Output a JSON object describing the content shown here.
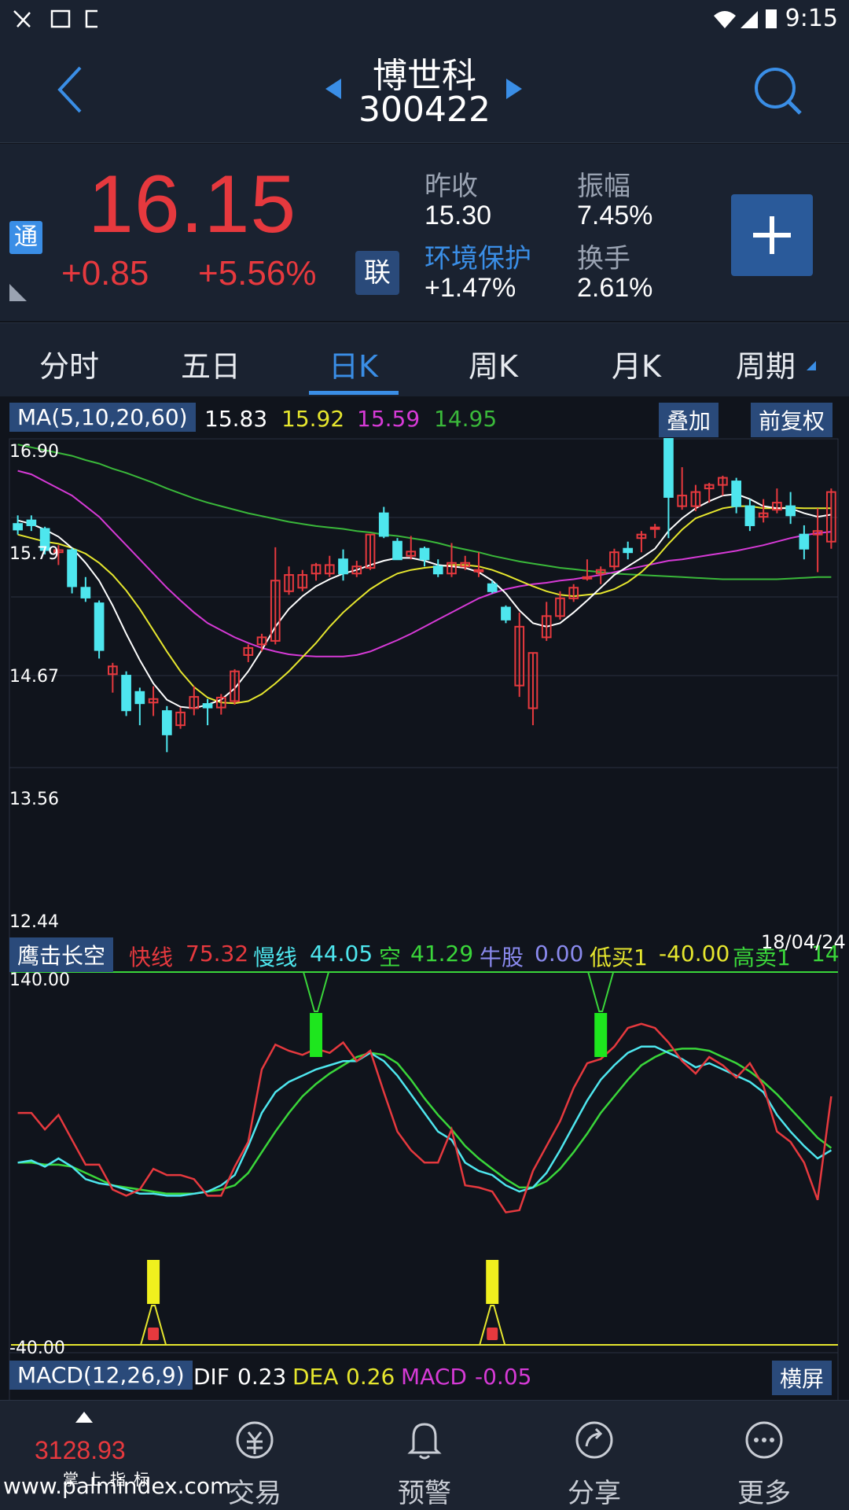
{
  "status_bar": {
    "time": "9:15"
  },
  "header": {
    "stock_name": "博世科",
    "stock_code": "300422"
  },
  "quote": {
    "price": "16.15",
    "change": "+0.85",
    "change_pct": "+5.56%",
    "badge_tong": "通",
    "badge_lian": "联",
    "prev_close_label": "昨收",
    "prev_close": "15.30",
    "amplitude_label": "振幅",
    "amplitude": "7.45%",
    "sector_label": "环境保护",
    "sector_change": "+1.47%",
    "turnover_label": "换手",
    "turnover": "2.61%"
  },
  "tabs": [
    "分时",
    "五日",
    "日K",
    "周K",
    "月K",
    "周期"
  ],
  "active_tab": "日K",
  "ma_legend": {
    "label": "MA(5,10,20,60)",
    "ma5": "15.83",
    "ma10": "15.92",
    "ma20": "15.59",
    "ma60": "14.95",
    "overlay_button": "叠加",
    "adjust_button": "前复权"
  },
  "price_axis": [
    "16.90",
    "15.79",
    "14.67",
    "13.56",
    "12.44"
  ],
  "date_label": "18/04/24",
  "indicator_legend": {
    "name": "鹰击长空",
    "fast_label": "快线",
    "fast": "75.32",
    "slow_label": "慢线",
    "slow": "44.05",
    "empty_label": "空",
    "empty": "41.29",
    "bull_label": "牛股",
    "bull": "0.00",
    "lowbuy_label": "低买1",
    "lowbuy": "-40.00",
    "highsell_label": "高卖1",
    "highsell": "14"
  },
  "indicator_axis": [
    "140.00",
    "-40.00"
  ],
  "macd_legend": {
    "label": "MACD(12,26,9)",
    "dif_label": "DIF",
    "dif": "0.23",
    "dea_label": "DEA",
    "dea": "0.26",
    "macd_label": "MACD",
    "macd": "-0.05",
    "landscape_button": "横屏"
  },
  "bottom_nav": {
    "index_value": "3128.93",
    "index_caption": "掌上指标",
    "watermark": "www.palmindex.com",
    "items": [
      "交易",
      "预警",
      "分享",
      "更多"
    ]
  },
  "colors": {
    "up": "#e6393e",
    "down": "#4ee6ee",
    "ma5": "#ffffff",
    "ma10": "#e6e62e",
    "ma20": "#d63ad6",
    "ma60": "#3ab83a",
    "accent": "#3a8ee6"
  },
  "chart_data": {
    "type": "candlestick",
    "ylim": [
      12.44,
      16.9
    ],
    "candles": [
      {
        "o": 15.7,
        "h": 15.82,
        "l": 15.55,
        "c": 15.62
      },
      {
        "o": 15.75,
        "h": 15.82,
        "l": 15.6,
        "c": 15.68
      },
      {
        "o": 15.63,
        "h": 15.66,
        "l": 15.27,
        "c": 15.33
      },
      {
        "o": 15.3,
        "h": 15.4,
        "l": 15.12,
        "c": 15.33
      },
      {
        "o": 15.33,
        "h": 15.36,
        "l": 14.72,
        "c": 14.82
      },
      {
        "o": 14.8,
        "h": 14.95,
        "l": 14.6,
        "c": 14.66
      },
      {
        "o": 14.58,
        "h": 14.62,
        "l": 13.8,
        "c": 13.92
      },
      {
        "o": 13.58,
        "h": 13.74,
        "l": 13.32,
        "c": 13.69
      },
      {
        "o": 13.56,
        "h": 13.62,
        "l": 12.99,
        "c": 13.07
      },
      {
        "o": 13.33,
        "h": 13.39,
        "l": 12.86,
        "c": 13.17
      },
      {
        "o": 13.18,
        "h": 13.41,
        "l": 12.99,
        "c": 13.23
      },
      {
        "o": 13.06,
        "h": 13.13,
        "l": 12.48,
        "c": 12.73
      },
      {
        "o": 12.86,
        "h": 13.11,
        "l": 12.81,
        "c": 13.04
      },
      {
        "o": 13.1,
        "h": 13.41,
        "l": 13.0,
        "c": 13.26
      },
      {
        "o": 13.16,
        "h": 13.23,
        "l": 12.86,
        "c": 13.11
      },
      {
        "o": 13.11,
        "h": 13.3,
        "l": 13.01,
        "c": 13.25
      },
      {
        "o": 13.2,
        "h": 13.65,
        "l": 13.15,
        "c": 13.62
      },
      {
        "o": 13.85,
        "h": 14.0,
        "l": 13.75,
        "c": 13.95
      },
      {
        "o": 14.0,
        "h": 14.15,
        "l": 13.9,
        "c": 14.1
      },
      {
        "o": 14.05,
        "h": 15.37,
        "l": 14.0,
        "c": 14.9
      },
      {
        "o": 14.75,
        "h": 15.1,
        "l": 14.7,
        "c": 14.98
      },
      {
        "o": 14.8,
        "h": 15.05,
        "l": 14.75,
        "c": 14.98
      },
      {
        "o": 15.0,
        "h": 15.15,
        "l": 14.9,
        "c": 15.12
      },
      {
        "o": 15.0,
        "h": 15.25,
        "l": 14.95,
        "c": 15.12
      },
      {
        "o": 15.2,
        "h": 15.34,
        "l": 14.9,
        "c": 15.0
      },
      {
        "o": 15.0,
        "h": 15.18,
        "l": 14.95,
        "c": 15.1
      },
      {
        "o": 15.08,
        "h": 15.55,
        "l": 15.05,
        "c": 15.55
      },
      {
        "o": 15.85,
        "h": 15.94,
        "l": 15.5,
        "c": 15.53
      },
      {
        "o": 15.45,
        "h": 15.5,
        "l": 15.2,
        "c": 15.2
      },
      {
        "o": 15.25,
        "h": 15.53,
        "l": 15.2,
        "c": 15.31
      },
      {
        "o": 15.35,
        "h": 15.38,
        "l": 15.1,
        "c": 15.2
      },
      {
        "o": 15.1,
        "h": 15.2,
        "l": 14.95,
        "c": 15.0
      },
      {
        "o": 15.0,
        "h": 15.43,
        "l": 14.95,
        "c": 15.15
      },
      {
        "o": 15.1,
        "h": 15.25,
        "l": 15.05,
        "c": 15.15
      },
      {
        "o": 15.05,
        "h": 15.3,
        "l": 14.95,
        "c": 15.05
      },
      {
        "o": 14.85,
        "h": 14.9,
        "l": 14.72,
        "c": 14.75
      },
      {
        "o": 14.52,
        "h": 14.55,
        "l": 14.3,
        "c": 14.35
      },
      {
        "o": 13.42,
        "h": 14.45,
        "l": 13.26,
        "c": 14.25
      },
      {
        "o": 13.1,
        "h": 13.88,
        "l": 12.86,
        "c": 13.88
      },
      {
        "o": 14.1,
        "h": 14.6,
        "l": 14.05,
        "c": 14.4
      },
      {
        "o": 14.4,
        "h": 14.75,
        "l": 14.35,
        "c": 14.65
      },
      {
        "o": 14.65,
        "h": 14.85,
        "l": 14.6,
        "c": 14.8
      },
      {
        "o": 14.95,
        "h": 15.2,
        "l": 14.9,
        "c": 14.95
      },
      {
        "o": 15.0,
        "h": 15.1,
        "l": 14.85,
        "c": 15.05
      },
      {
        "o": 15.1,
        "h": 15.35,
        "l": 15.05,
        "c": 15.3
      },
      {
        "o": 15.35,
        "h": 15.45,
        "l": 15.2,
        "c": 15.3
      },
      {
        "o": 15.5,
        "h": 15.6,
        "l": 15.3,
        "c": 15.55
      },
      {
        "o": 15.65,
        "h": 15.7,
        "l": 15.5,
        "c": 15.65
      },
      {
        "o": 16.9,
        "h": 16.9,
        "l": 15.5,
        "c": 16.08
      },
      {
        "o": 15.95,
        "h": 16.5,
        "l": 15.9,
        "c": 16.1
      },
      {
        "o": 15.95,
        "h": 16.25,
        "l": 15.88,
        "c": 16.15
      },
      {
        "o": 16.2,
        "h": 16.28,
        "l": 16.0,
        "c": 16.25
      },
      {
        "o": 16.25,
        "h": 16.38,
        "l": 16.1,
        "c": 16.35
      },
      {
        "o": 16.3,
        "h": 16.35,
        "l": 15.85,
        "c": 15.95
      },
      {
        "o": 15.95,
        "h": 16.05,
        "l": 15.6,
        "c": 15.68
      },
      {
        "o": 15.8,
        "h": 16.05,
        "l": 15.72,
        "c": 15.85
      },
      {
        "o": 15.9,
        "h": 16.2,
        "l": 15.85,
        "c": 16.0
      },
      {
        "o": 15.95,
        "h": 16.15,
        "l": 15.7,
        "c": 15.82
      },
      {
        "o": 15.55,
        "h": 15.68,
        "l": 15.2,
        "c": 15.35
      },
      {
        "o": 15.55,
        "h": 15.92,
        "l": 15.02,
        "c": 15.6
      },
      {
        "o": 15.45,
        "h": 16.2,
        "l": 15.35,
        "c": 16.15
      }
    ],
    "ma": {
      "ma5": [
        15.75,
        15.7,
        15.62,
        15.52,
        15.36,
        15.15,
        14.9,
        14.55,
        14.15,
        13.78,
        13.45,
        13.22,
        13.12,
        13.1,
        13.15,
        13.22,
        13.38,
        13.62,
        13.92,
        14.25,
        14.5,
        14.68,
        14.82,
        14.92,
        15.0,
        15.05,
        15.12,
        15.18,
        15.22,
        15.22,
        15.18,
        15.12,
        15.1,
        15.08,
        15.02,
        14.9,
        14.72,
        14.48,
        14.3,
        14.25,
        14.3,
        14.45,
        14.62,
        14.8,
        14.98,
        15.1,
        15.22,
        15.35,
        15.6,
        15.78,
        15.92,
        16.02,
        16.1,
        16.12,
        16.05,
        15.95,
        15.92,
        15.92,
        15.85,
        15.8,
        15.83
      ],
      "ma10": [
        15.55,
        15.5,
        15.45,
        15.42,
        15.36,
        15.28,
        15.15,
        14.98,
        14.76,
        14.5,
        14.2,
        13.9,
        13.62,
        13.4,
        13.25,
        13.18,
        13.17,
        13.2,
        13.3,
        13.45,
        13.62,
        13.82,
        14.02,
        14.25,
        14.45,
        14.62,
        14.78,
        14.9,
        15.0,
        15.05,
        15.08,
        15.1,
        15.12,
        15.12,
        15.1,
        15.05,
        14.98,
        14.9,
        14.82,
        14.75,
        14.7,
        14.68,
        14.7,
        14.72,
        14.78,
        14.88,
        15.02,
        15.2,
        15.42,
        15.62,
        15.78,
        15.85,
        15.92,
        15.95,
        15.95,
        15.92,
        15.92,
        15.93,
        15.92,
        15.92,
        15.92
      ],
      "ma20": [
        16.45,
        16.4,
        16.3,
        16.2,
        16.1,
        15.95,
        15.8,
        15.6,
        15.4,
        15.2,
        15.0,
        14.8,
        14.62,
        14.45,
        14.3,
        14.2,
        14.1,
        14.02,
        13.95,
        13.9,
        13.86,
        13.84,
        13.83,
        13.83,
        13.83,
        13.85,
        13.9,
        13.98,
        14.06,
        14.15,
        14.25,
        14.35,
        14.45,
        14.55,
        14.65,
        14.72,
        14.78,
        14.82,
        14.85,
        14.87,
        14.9,
        14.92,
        14.95,
        14.98,
        15.02,
        15.06,
        15.1,
        15.14,
        15.18,
        15.2,
        15.23,
        15.26,
        15.29,
        15.32,
        15.36,
        15.4,
        15.45,
        15.5,
        15.54,
        15.57,
        15.59
      ],
      "ma60": [
        16.82,
        16.78,
        16.74,
        16.7,
        16.66,
        16.6,
        16.55,
        16.48,
        16.42,
        16.35,
        16.28,
        16.2,
        16.13,
        16.06,
        16.0,
        15.95,
        15.9,
        15.85,
        15.81,
        15.77,
        15.73,
        15.7,
        15.67,
        15.65,
        15.63,
        15.6,
        15.58,
        15.55,
        15.53,
        15.5,
        15.47,
        15.43,
        15.38,
        15.34,
        15.3,
        15.25,
        15.21,
        15.17,
        15.14,
        15.11,
        15.08,
        15.06,
        15.04,
        15.02,
        15.0,
        14.99,
        14.98,
        14.97,
        14.96,
        14.95,
        14.94,
        14.93,
        14.92,
        14.92,
        14.92,
        14.92,
        14.92,
        14.93,
        14.94,
        14.95,
        14.95
      ]
    },
    "indicator": {
      "ylim": [
        -40,
        140
      ],
      "fast": [
        72,
        72,
        64,
        71,
        59,
        47,
        47,
        35,
        32,
        35,
        45,
        42,
        42,
        40,
        32,
        32,
        46,
        58,
        93,
        105,
        102,
        100,
        103,
        101,
        106,
        97,
        102,
        82,
        63,
        54,
        48,
        48,
        64,
        37,
        36,
        34,
        24,
        25,
        44,
        56,
        68,
        84,
        96,
        98,
        104,
        113,
        115,
        113,
        106,
        97,
        91,
        99,
        95,
        89,
        96,
        85,
        63,
        58,
        48,
        30,
        80
      ],
      "slow": [
        48,
        49,
        46,
        50,
        46,
        40,
        38,
        37,
        35,
        33,
        33,
        32,
        32,
        33,
        34,
        37,
        42,
        56,
        72,
        82,
        87,
        90,
        93,
        95,
        97,
        97,
        101,
        97,
        90,
        81,
        72,
        63,
        59,
        48,
        44,
        42,
        37,
        34,
        36,
        43,
        54,
        66,
        78,
        88,
        95,
        101,
        104,
        104,
        101,
        98,
        94,
        96,
        93,
        90,
        87,
        82,
        71,
        63,
        56,
        50,
        54
      ],
      "empty": [
        48,
        48,
        47,
        47,
        46,
        43,
        40,
        37,
        36,
        35,
        34,
        33,
        33,
        33,
        34,
        35,
        37,
        43,
        53,
        63,
        72,
        80,
        86,
        91,
        95,
        99,
        101,
        100,
        96,
        88,
        79,
        71,
        64,
        56,
        50,
        45,
        40,
        36,
        36,
        39,
        45,
        53,
        62,
        72,
        80,
        88,
        95,
        99,
        102,
        103,
        103,
        102,
        99,
        96,
        92,
        87,
        81,
        74,
        67,
        60,
        55
      ]
    }
  }
}
